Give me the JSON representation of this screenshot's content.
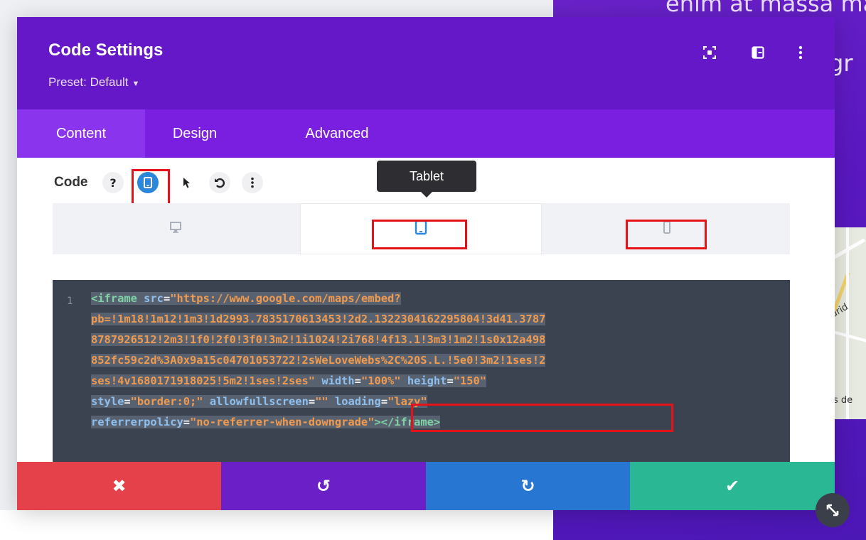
{
  "background": {
    "heading_line1": "enim at massa ma",
    "heading_line2": "gr",
    "map_label1": "drid",
    "map_label2": "os de"
  },
  "modal": {
    "title": "Code Settings",
    "preset_label": "Preset: Default",
    "header_icons": [
      "focus-icon",
      "split-view-icon",
      "more-vertical-icon"
    ],
    "tabs": [
      {
        "label": "Content",
        "active": true
      },
      {
        "label": "Design",
        "active": false
      },
      {
        "label": "Advanced",
        "active": false
      }
    ]
  },
  "field": {
    "label": "Code",
    "help_glyph": "?",
    "toolbar_icons": [
      "help-icon",
      "responsive-tablet-icon",
      "pointer-icon",
      "reset-icon",
      "options-icon"
    ],
    "tooltip": "Tablet",
    "devices": [
      {
        "name": "desktop",
        "active": false
      },
      {
        "name": "tablet",
        "active": true
      },
      {
        "name": "phone",
        "active": false
      }
    ]
  },
  "editor": {
    "line_number": "1",
    "lines": [
      [
        [
          "tag",
          "<iframe "
        ],
        [
          "attr",
          "src"
        ],
        [
          "eq",
          "="
        ],
        [
          "str",
          "\"https://www.google.com/maps/embed?"
        ]
      ],
      [
        [
          "str",
          "pb=!1m18!1m12!1m3!1d2993.7835170613453!2d2.1322304162295804!3d41.3787"
        ]
      ],
      [
        [
          "str",
          "8787926512!2m3!1f0!2f0!3f0!3m2!1i1024!2i768!4f13.1!3m3!1m2!1s0x12a498"
        ]
      ],
      [
        [
          "str",
          "852fc59c2d%3A0x9a15c04701053722!2sWeLoveWebs%2C%20S.L.!5e0!3m2!1ses!2"
        ]
      ],
      [
        [
          "str",
          "ses!4v1680171918025!5m2!1ses!2ses\""
        ],
        [
          "eq",
          " "
        ],
        [
          "attr",
          "width"
        ],
        [
          "eq",
          "="
        ],
        [
          "str",
          "\"100%\""
        ],
        [
          "eq",
          " "
        ],
        [
          "attr",
          "height"
        ],
        [
          "eq",
          "="
        ],
        [
          "str",
          "\"150\""
        ]
      ],
      [
        [
          "attr",
          "style"
        ],
        [
          "eq",
          "="
        ],
        [
          "str",
          "\"border:0;\""
        ],
        [
          "eq",
          " "
        ],
        [
          "attr",
          "allowfullscreen"
        ],
        [
          "eq",
          "="
        ],
        [
          "str",
          "\"\""
        ],
        [
          "eq",
          " "
        ],
        [
          "attr",
          "loading"
        ],
        [
          "eq",
          "="
        ],
        [
          "str",
          "\"lazy\""
        ]
      ],
      [
        [
          "attr",
          "referrerpolicy"
        ],
        [
          "eq",
          "="
        ],
        [
          "str",
          "\"no-referrer-when-downgrade\""
        ],
        [
          "tag",
          "></iframe>"
        ]
      ]
    ]
  },
  "footer": {
    "buttons": [
      {
        "name": "discard",
        "glyph": "✖",
        "color": "#e5414a"
      },
      {
        "name": "undo",
        "glyph": "↺",
        "color": "#6a1fc7"
      },
      {
        "name": "redo",
        "glyph": "↻",
        "color": "#2776d1"
      },
      {
        "name": "save",
        "glyph": "✔",
        "color": "#29b794"
      }
    ]
  },
  "colors": {
    "header_bg": "#6418c7",
    "tabs_bg": "#7a1fe0",
    "active_tab_bg": "#8a34ee",
    "editor_bg": "#3c4350",
    "highlight_red": "#e6121a",
    "accent_blue": "#2b87da"
  }
}
